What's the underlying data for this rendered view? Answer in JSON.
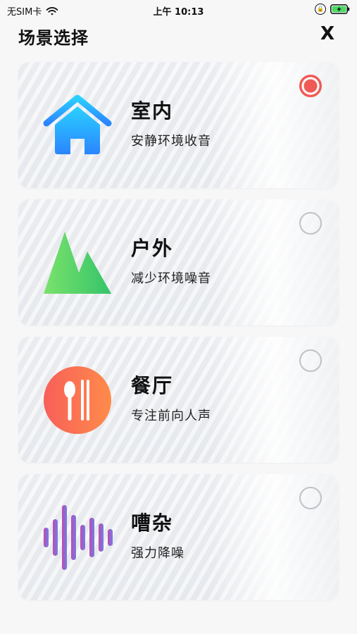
{
  "status_bar": {
    "carrier": "无SIM卡",
    "time": "上午 10:13",
    "wifi_icon": "wifi-icon",
    "lock_icon": "orientation-lock-icon",
    "battery_icon": "battery-charging-icon"
  },
  "header": {
    "title": "场景选择",
    "close_label": "X"
  },
  "colors": {
    "accent_selected": "#ef5a55",
    "radio_border": "#bfc2c6",
    "home_gradient_top": "#2ad0ff",
    "home_gradient_bottom": "#2b85ff",
    "mountain_gradient_left": "#7be26b",
    "mountain_gradient_right": "#34c46a",
    "restaurant_gradient_left": "#f85f5a",
    "restaurant_gradient_right": "#ff8b4a",
    "sound_gradient_left": "#c14ab0",
    "sound_gradient_right": "#6d7fe6"
  },
  "scenes": [
    {
      "name": "室内",
      "desc": "安静环境收音",
      "icon": "home-icon",
      "selected": true
    },
    {
      "name": "户外",
      "desc": "减少环境噪音",
      "icon": "mountain-icon",
      "selected": false
    },
    {
      "name": "餐厅",
      "desc": "专注前向人声",
      "icon": "restaurant-icon",
      "selected": false
    },
    {
      "name": "嘈杂",
      "desc": "强力降噪",
      "icon": "sound-wave-icon",
      "selected": false
    }
  ]
}
